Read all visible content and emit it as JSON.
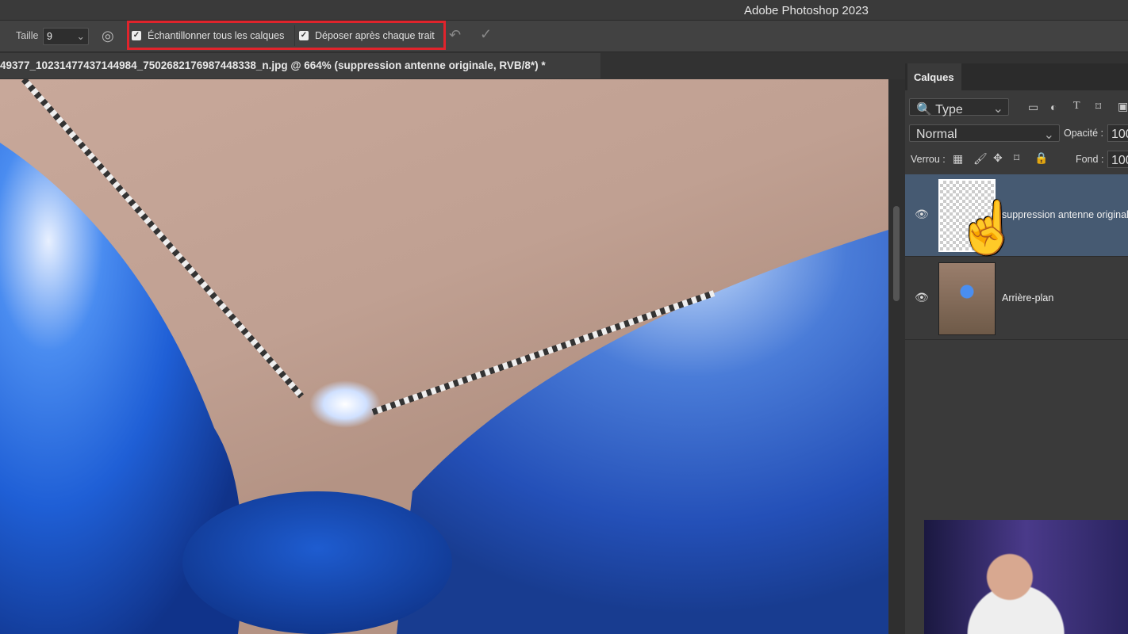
{
  "app": {
    "title": "Adobe Photoshop 2023"
  },
  "options": {
    "size_label": "Taille",
    "size_value": "9",
    "sample_all_label": "Échantillonner tous les calques",
    "sample_all_checked": true,
    "deposit_label": "Déposer après chaque trait",
    "deposit_checked": true,
    "highlight_color": "#e0242c"
  },
  "document": {
    "tab_title": "49377_10231477437144984_7502682176987448338_n.jpg @ 664% (suppression antenne originale, RVB/8*) *"
  },
  "layers_panel": {
    "tab": "Calques",
    "filter": "Type",
    "blend_mode": "Normal",
    "opacity_label": "Opacité :",
    "opacity": "100",
    "lock_label": "Verrou :",
    "fill_label": "Fond :",
    "fill": "100",
    "layers": [
      {
        "name": "suppression antenne originale",
        "visible": true,
        "selected": true
      },
      {
        "name": "Arrière-plan",
        "visible": true,
        "selected": false
      }
    ]
  }
}
